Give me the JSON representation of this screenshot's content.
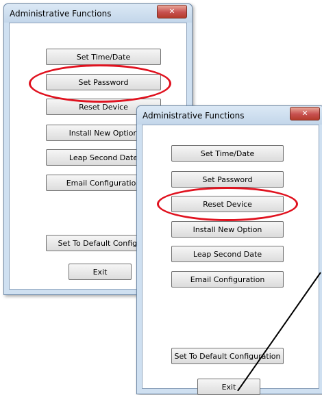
{
  "back_dialog": {
    "title": "Administrative Functions",
    "close_glyph": "✕",
    "buttons": [
      "Set Time/Date",
      "Set Password",
      "Reset Device",
      "Install New Option",
      "Leap Second Date",
      "Email Configuration",
      "Set To Default Configuration",
      "Exit"
    ]
  },
  "front_dialog": {
    "title": "Administrative Functions",
    "close_glyph": "✕",
    "buttons": [
      "Set Time/Date",
      "Set Password",
      "Reset Device",
      "Install New Option",
      "Leap Second Date",
      "Email Configuration",
      "Set To Default Configuration",
      "Exit"
    ]
  },
  "colors": {
    "highlight": "#e0121f",
    "title_bar": "#cfe0f1",
    "close_button": "#c75050"
  },
  "icons": [
    "close-icon"
  ]
}
